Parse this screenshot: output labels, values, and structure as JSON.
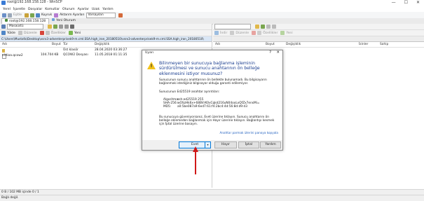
{
  "window": {
    "title": "root@192.168.158.128 - WinSCP",
    "controls": [
      "—",
      "☐",
      "✕"
    ]
  },
  "menu": [
    "Yerel",
    "İşaretle",
    "Dosyalar",
    "Komutlar",
    "Oturum",
    "Ayarlar",
    "Uzak",
    "Yardım"
  ],
  "toolbar": {
    "sync_label": "Eşitle",
    "queue_label": "Kuyruk",
    "transfer_settings_label": "Aktarım Ayarları",
    "transfer_default": "Varsayılan"
  },
  "tabs": [
    {
      "label": "root@192.168.158.128",
      "active": true
    },
    {
      "label": "Yeni Oturum",
      "active": false
    }
  ],
  "left": {
    "drive": "Masaüstü",
    "tb_buttons": [
      "Yükle",
      "Düzenle",
      "Özellikler",
      "Yeni"
    ],
    "path": "C:\\Users\\Mustafa\\Desktop\\vsrx3-adventerprisek9-m.cml.SSA.high_iron_20180510\\vsrx3-adventerprisek9-m.cml.SSA.high_iron_20180510\\",
    "columns": [
      "Adı",
      "Boyut",
      "Tür",
      "Değişiklik"
    ],
    "files": [
      {
        "name": "..",
        "size": "",
        "type": "Üst klasör",
        "modified": "28.04.2020 03:36:27"
      },
      {
        "name": "virtioa.qcow2",
        "size": "104.704 KB",
        "type": "QCOW2 Dosyası",
        "modified": "11.05.2018 01:11:35"
      }
    ]
  },
  "right": {
    "tb_buttons": [
      "İndir",
      "Düzenle",
      "Özellikler",
      "Yeni"
    ],
    "columns": [
      "Adı",
      "Boyut",
      "Değişiklik",
      "İzinler",
      "Sahip"
    ]
  },
  "status": {
    "selection": "0 B / 102 MB içinde 0 / 1",
    "connection": "Bağlı değil."
  },
  "dialog": {
    "title": "Uyarı",
    "help": "?",
    "close": "✕",
    "warning_mark": "!",
    "heading": "Bilinmeyen bir sunucuya bağlanma işleminin sürdürülmesi ve sunucu anahtarının ön belleğe eklenmesini istiyor musunuz?",
    "para1": "Sunucunun sunucu anahtarının ön bellekte bulunamadı. Bu bilgisayarın bağlanmak istediğiniz bilgisayar olduğu garanti edilemiyor.",
    "para2": "Sunucunun Ed25519 anahtar ayrıntıları:",
    "algorithm_key": "Algoritma:",
    "algorithm_val": "ssh-ed25519 255",
    "sha_key": "SHA-256:",
    "sha_val": "wOSzHk6x+68BVrK0vCqkd216uN04ooLxQfZx7ensMi=",
    "md5_key": "MD5:",
    "md5_val": "a0:5be087a9:6ed7:61:f4:2bc4:4d:56:8d:d9:d3",
    "para3": "Bu sunucuya güveniyorsanız, Evet üzerine tıklayın. Sunucu anahtarını ön belleğe eklemeden bağlanmak için Hayır üzerine tıklayın. Bağlantıyı kesmek için İptal üzerine basayın.",
    "link": "Anahtar parmak izlerini panoya kopyala",
    "buttons": {
      "yes": "Evet",
      "no": "Hayır",
      "cancel": "İptal",
      "help": "Yardım"
    }
  },
  "colors": {
    "heading": "#1a3d8f",
    "path_active": "#d9e6f5",
    "arrow": "#d01818",
    "warning": "#f2c21a",
    "link": "#1f5fbf"
  }
}
